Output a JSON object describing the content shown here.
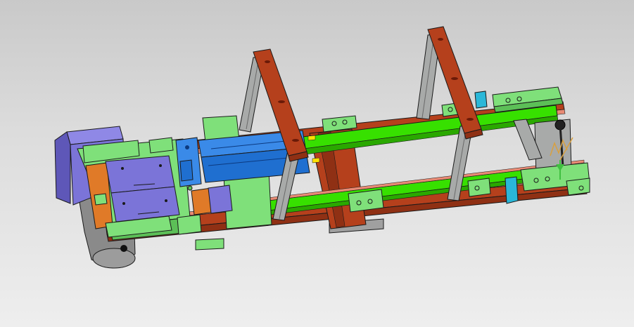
{
  "viewport": {
    "background_top": "#c9c9c9",
    "background_bottom": "#eeeeee"
  },
  "assembly": {
    "frame_color": "#b5401c",
    "rail_color": "#e88a74",
    "guide_color": "#37e000",
    "bracket_color": "#7fe07a",
    "upright_color": "#a8aaa9",
    "upright_edge_color": "#6a6a6a",
    "arm_color": "#b5401c",
    "cylinder_color": "#1f6fd0",
    "motor_color": "#7b74d8",
    "motor_housing_color": "#8a8a8a",
    "plate_color": "#7b74d8",
    "side_plate_color": "#e07a28",
    "sensor_color": "#2ab7d8",
    "edge_color": "#1a1a1a"
  },
  "triad": {
    "x_axis_color": "#d8a040",
    "y_axis_color": "#40c040",
    "icon": "coordinate-triad-icon"
  }
}
